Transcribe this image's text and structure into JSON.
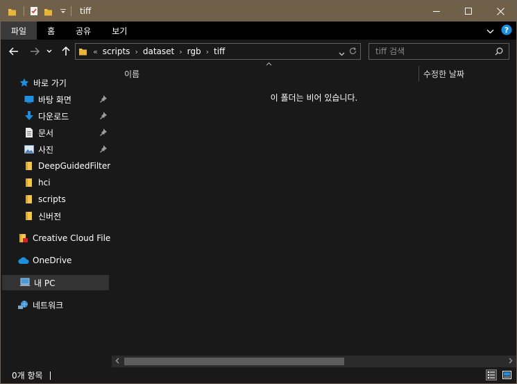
{
  "window": {
    "title": "tiff"
  },
  "ribbon": {
    "tabs": [
      {
        "label": "파일",
        "active": true
      },
      {
        "label": "홈",
        "active": false
      },
      {
        "label": "공유",
        "active": false
      },
      {
        "label": "보기",
        "active": false
      }
    ]
  },
  "address": {
    "overflow": "«",
    "crumbs": [
      "scripts",
      "dataset",
      "rgb",
      "tiff"
    ]
  },
  "search": {
    "placeholder": "tiff 검색"
  },
  "sidebar": {
    "quick_access": "바로 가기",
    "pinned": [
      {
        "label": "바탕 화면",
        "icon": "desktop-icon"
      },
      {
        "label": "다운로드",
        "icon": "download-icon"
      },
      {
        "label": "문서",
        "icon": "document-icon"
      },
      {
        "label": "사진",
        "icon": "pictures-icon"
      }
    ],
    "folders": [
      {
        "label": "DeepGuidedFilteringNetwork"
      },
      {
        "label": "hci"
      },
      {
        "label": "scripts"
      },
      {
        "label": "신버전"
      }
    ],
    "creative_cloud": "Creative Cloud Files",
    "onedrive": "OneDrive",
    "this_pc": "내 PC",
    "network": "네트워크"
  },
  "columns": {
    "name": "이름",
    "date_modified": "수정한 날짜"
  },
  "content": {
    "empty_message": "이 폴더는 비어 있습니다."
  },
  "status": {
    "item_count": "0개 항목"
  },
  "colors": {
    "titlebar": "#705f49",
    "folder": "#f3c64a",
    "accent_blue": "#1e8fdf"
  }
}
